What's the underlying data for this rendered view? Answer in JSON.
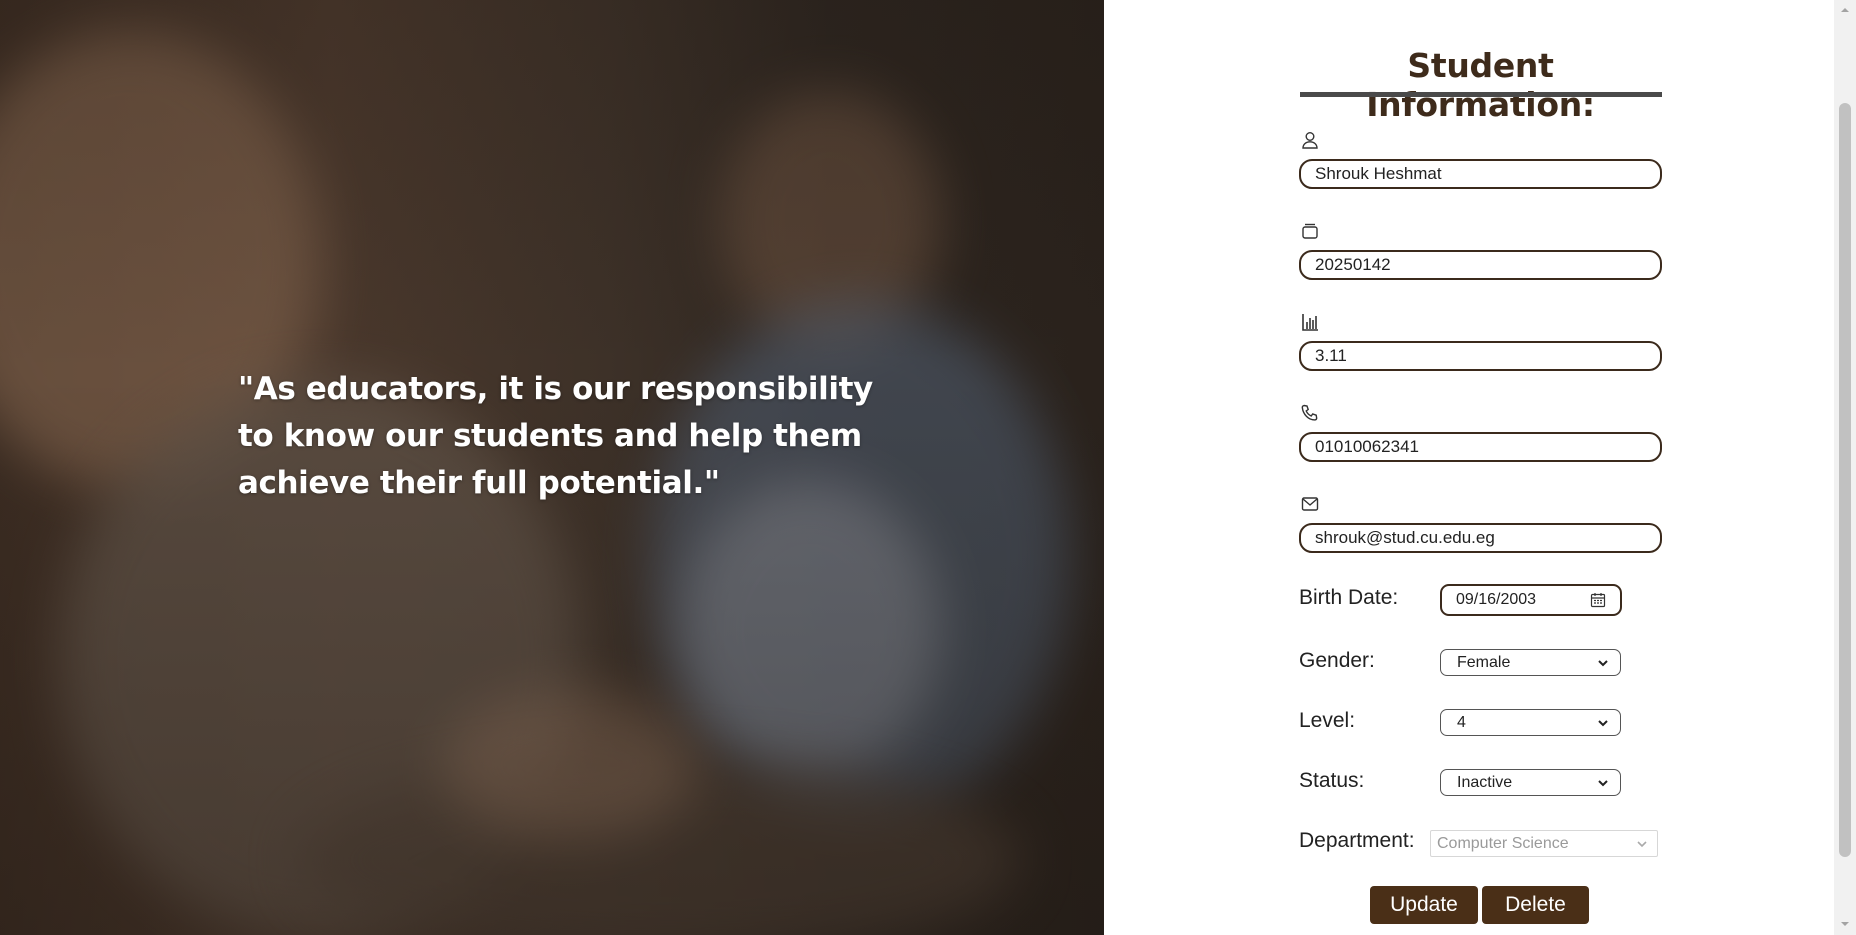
{
  "hero": {
    "quote": "\"As educators, it is our responsibility to know our students and help them achieve their full potential.\""
  },
  "form": {
    "title": "Student Information:",
    "fields": {
      "name": {
        "icon": "user-icon",
        "value": "Shrouk Heshmat"
      },
      "student_id": {
        "icon": "id-card-icon",
        "value": "20250142"
      },
      "gpa": {
        "icon": "bar-chart-icon",
        "value": "3.11"
      },
      "phone": {
        "icon": "phone-icon",
        "value": "01010062341"
      },
      "email": {
        "icon": "envelope-icon",
        "value": "shrouk@stud.cu.edu.eg"
      }
    },
    "birth_date": {
      "label": "Birth Date:",
      "value": "09/16/2003",
      "icon": "calendar-icon"
    },
    "gender": {
      "label": "Gender:",
      "selected": "Female"
    },
    "level": {
      "label": "Level:",
      "selected": "4"
    },
    "status": {
      "label": "Status:",
      "selected": "Inactive"
    },
    "department": {
      "label": "Department:",
      "selected": "Computer Science",
      "disabled": true
    },
    "buttons": {
      "update": "Update",
      "delete": "Delete"
    }
  },
  "colors": {
    "accent": "#4a2f17",
    "title": "#3e2b1b",
    "input_border": "#3b2a1c"
  }
}
